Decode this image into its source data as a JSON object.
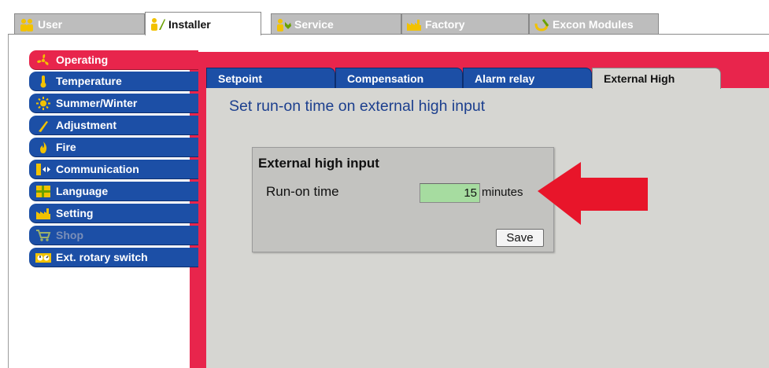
{
  "top_tabs": [
    {
      "label": "User",
      "icon": "user-icon"
    },
    {
      "label": "Installer",
      "icon": "installer-icon",
      "active": true
    },
    {
      "label": "Service",
      "icon": "service-icon"
    },
    {
      "label": "Factory",
      "icon": "factory-icon"
    },
    {
      "label": "Excon Modules",
      "icon": "excon-modules-icon"
    }
  ],
  "sidebar": {
    "items": [
      {
        "label": "Operating",
        "icon": "fan-icon",
        "active": true
      },
      {
        "label": "Temperature",
        "icon": "thermometer-icon"
      },
      {
        "label": "Summer/Winter",
        "icon": "sun-icon"
      },
      {
        "label": "Adjustment",
        "icon": "screwdriver-icon"
      },
      {
        "label": "Fire",
        "icon": "fire-icon"
      },
      {
        "label": "Communication",
        "icon": "communication-icon"
      },
      {
        "label": "Language",
        "icon": "language-icon"
      },
      {
        "label": "Setting",
        "icon": "setting-icon"
      },
      {
        "label": "Shop",
        "icon": "cart-icon",
        "disabled": true
      },
      {
        "label": "Ext. rotary switch",
        "icon": "rotary-switch-icon"
      }
    ]
  },
  "sub_tabs": [
    {
      "label": "Setpoint"
    },
    {
      "label": "Compensation"
    },
    {
      "label": "Alarm relay"
    },
    {
      "label": "External High",
      "active": true
    }
  ],
  "main": {
    "heading": "Set run-on time on external high input",
    "group": {
      "title": "External high input",
      "run_on_label": "Run-on time",
      "run_on_value": "15",
      "run_on_unit": "minutes",
      "save_label": "Save"
    }
  },
  "colors": {
    "accent_red": "#e8254c",
    "nav_blue": "#1c4fa6",
    "input_green": "#a6dca0",
    "arrow_red": "#e8152a"
  }
}
